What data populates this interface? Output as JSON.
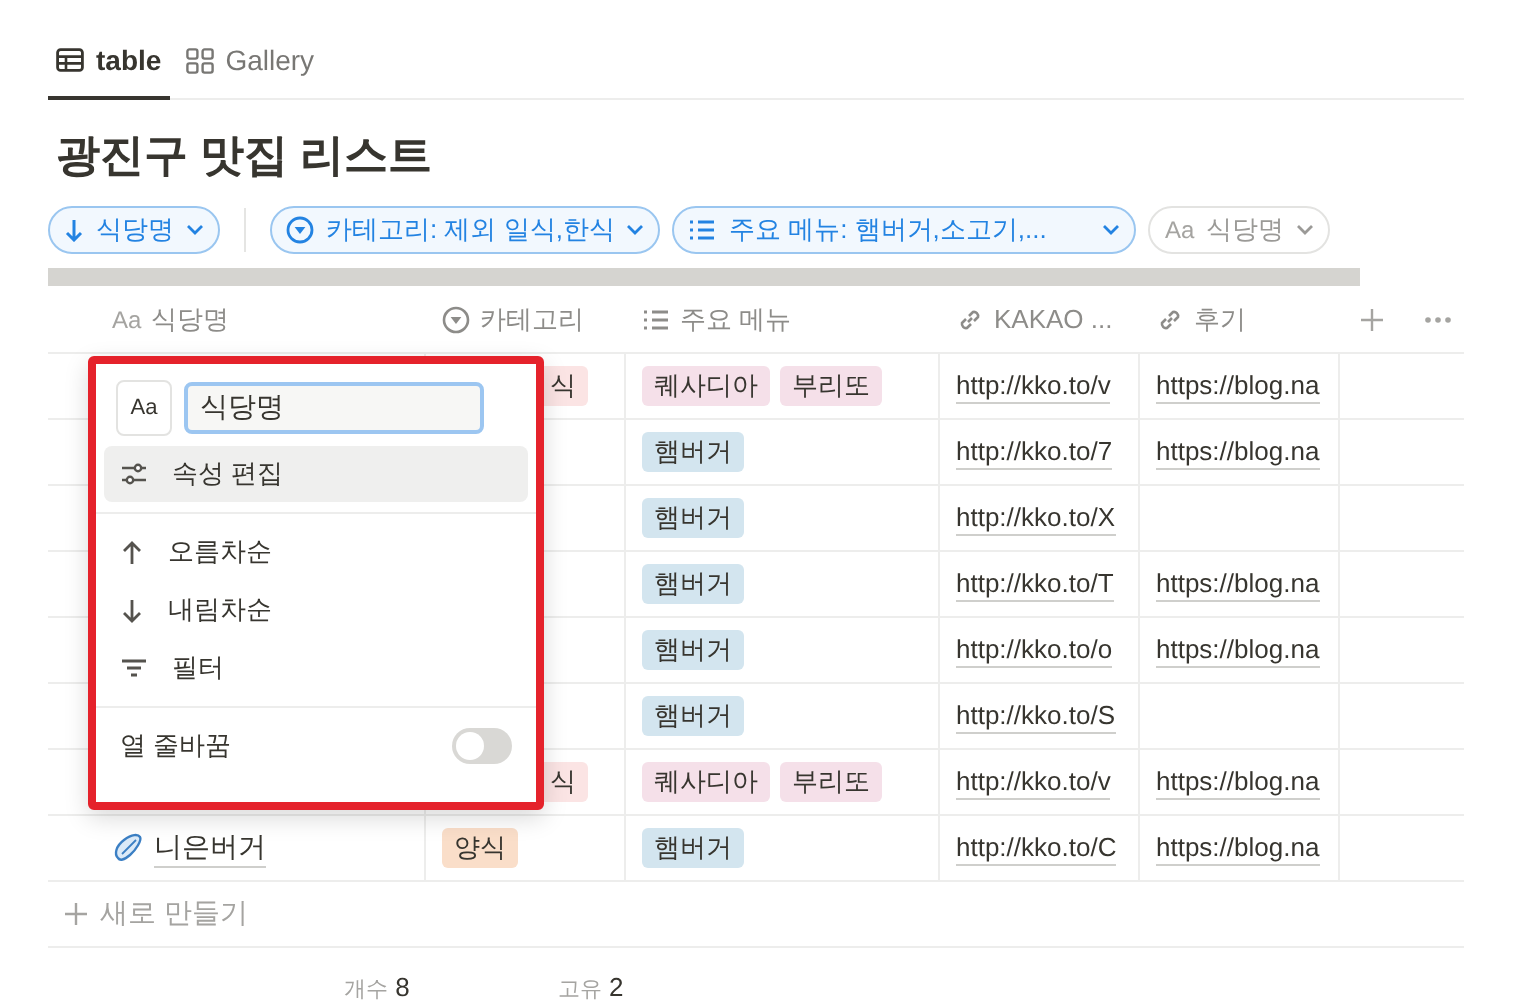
{
  "tabs": [
    {
      "label": "table",
      "kind": "table",
      "selected": true
    },
    {
      "label": "Gallery",
      "kind": "gallery",
      "selected": false
    }
  ],
  "title": "광진구 맛집 리스트",
  "filters": [
    {
      "kind": "sort",
      "label": "식당명"
    },
    {
      "kind": "select",
      "label": "카테고리: 제외 일식,한식"
    },
    {
      "kind": "multi",
      "label": "주요 메뉴: 햄버거,소고기,..."
    },
    {
      "kind": "inactive",
      "icon_text": "Aa",
      "label": "식당명"
    }
  ],
  "columns": [
    {
      "kind": "title",
      "icon_text": "Aa",
      "label": "식당명"
    },
    {
      "kind": "select",
      "label": "카테고리"
    },
    {
      "kind": "multi",
      "label": "주요 메뉴"
    },
    {
      "kind": "url",
      "label": "KAKAO ..."
    },
    {
      "kind": "url",
      "label": "후기"
    }
  ],
  "rows": [
    {
      "category": {
        "label": "식",
        "color": "#fbe4e4",
        "cut": true
      },
      "menu": [
        {
          "label": "퀘사디아",
          "color": "#f5e0e9"
        },
        {
          "label": "부리또",
          "color": "#f5e0e9"
        }
      ],
      "kakao": "http://kko.to/v",
      "review": "https://blog.na"
    },
    {
      "menu": [
        {
          "label": "햄버거",
          "color": "#d3e5ef"
        }
      ],
      "kakao": "http://kko.to/7",
      "review": "https://blog.na"
    },
    {
      "menu": [
        {
          "label": "햄버거",
          "color": "#d3e5ef"
        }
      ],
      "kakao": "http://kko.to/X"
    },
    {
      "menu": [
        {
          "label": "햄버거",
          "color": "#d3e5ef"
        }
      ],
      "kakao": "http://kko.to/T",
      "review": "https://blog.na"
    },
    {
      "menu": [
        {
          "label": "햄버거",
          "color": "#d3e5ef"
        }
      ],
      "kakao": "http://kko.to/o",
      "review": "https://blog.na"
    },
    {
      "menu": [
        {
          "label": "햄버거",
          "color": "#d3e5ef"
        }
      ],
      "kakao": "http://kko.to/S"
    },
    {
      "category": {
        "label": "식",
        "color": "#fbe4e4",
        "cut": true
      },
      "menu": [
        {
          "label": "퀘사디아",
          "color": "#f5e0e9"
        },
        {
          "label": "부리또",
          "color": "#f5e0e9"
        }
      ],
      "kakao": "http://kko.to/v",
      "review": "https://blog.na"
    },
    {
      "name": "니은버거",
      "category": {
        "label": "양식",
        "color": "#fadec9"
      },
      "menu": [
        {
          "label": "햄버거",
          "color": "#d3e5ef"
        }
      ],
      "kakao": "http://kko.to/C",
      "review": "https://blog.na"
    }
  ],
  "new_row": "새로 만들기",
  "footer": [
    {
      "label": "개수",
      "value": "8"
    },
    {
      "label": "고유",
      "value": "2"
    }
  ],
  "popup": {
    "type_label": "Aa",
    "name_value": "식당명",
    "items": [
      {
        "kind": "edit",
        "label": "속성 편집",
        "selected": true
      },
      {
        "kind": "divider"
      },
      {
        "kind": "asc",
        "label": "오름차순",
        "selected": false
      },
      {
        "kind": "desc",
        "label": "내림차순",
        "selected": false
      },
      {
        "kind": "filter",
        "label": "필터",
        "selected": false
      },
      {
        "kind": "divider"
      }
    ],
    "wrap": {
      "label": "열 줄바꿈",
      "on": false
    }
  }
}
